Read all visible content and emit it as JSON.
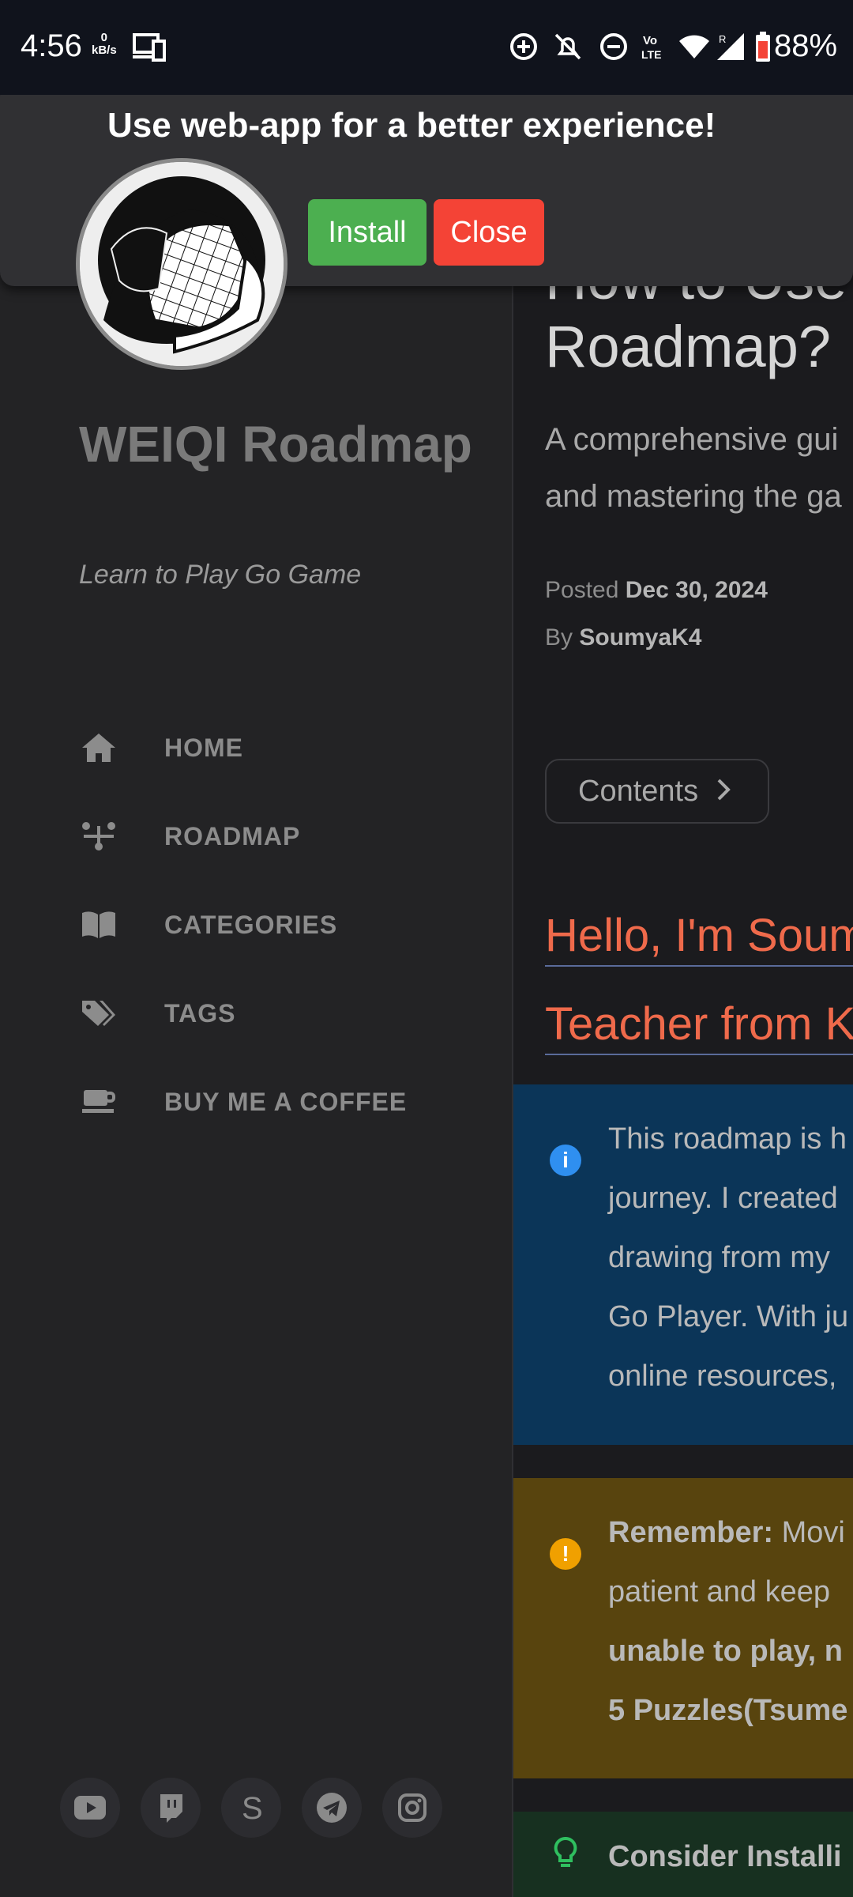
{
  "status_bar": {
    "time": "4:56",
    "net_speed_value": "0",
    "net_speed_unit": "kB/s",
    "battery": "88%"
  },
  "popup": {
    "title": "Use web-app for a better experience!",
    "install_label": "Install",
    "close_label": "Close"
  },
  "sidebar": {
    "title": "WEIQI Roadmap",
    "subtitle": "Learn to Play Go Game",
    "nav": [
      {
        "label": "HOME",
        "icon": "home-icon"
      },
      {
        "label": "ROADMAP",
        "icon": "roadmap-icon"
      },
      {
        "label": "CATEGORIES",
        "icon": "book-icon"
      },
      {
        "label": "TAGS",
        "icon": "tags-icon"
      },
      {
        "label": "BUY ME A COFFEE",
        "icon": "coffee-icon"
      }
    ],
    "socials": [
      "youtube-icon",
      "twitch-icon",
      "s-icon",
      "telegram-icon",
      "instagram-icon"
    ]
  },
  "post": {
    "title_line1": "How to Use",
    "title_line2": "Roadmap?",
    "desc_line1": "A comprehensive gui",
    "desc_line2": "and mastering the ga",
    "posted_label": "Posted",
    "posted_date": "Dec 30, 2024",
    "by_label": "By",
    "author": "SoumyaK4",
    "contents_label": "Contents",
    "hello_line1": "Hello, I'm Soum",
    "hello_line2": "Teacher from K"
  },
  "info_box": {
    "lines": [
      "This roadmap is h",
      "journey. I created",
      "drawing from my",
      "Go Player. With ju",
      "online resources,"
    ]
  },
  "warning_box": {
    "bold": "Remember:",
    "line1_rest": " Movi",
    "line2": "patient and keep",
    "line3_bold": "unable to play, n",
    "line4_bold": "5 Puzzles(Tsume"
  },
  "tip_box": {
    "bold": "Consider Installi"
  },
  "colors": {
    "accent_heading": "#ef6a4b",
    "install": "#4caf50",
    "close": "#f44336",
    "info_bg": "#0b3558",
    "warning_bg": "#58440e",
    "tip_bg": "#173020"
  }
}
